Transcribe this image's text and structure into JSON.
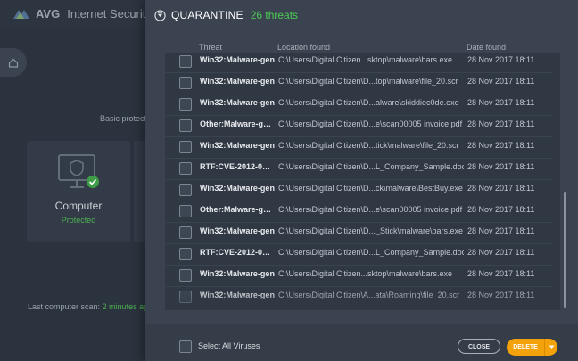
{
  "app": {
    "brand": "AVG",
    "product": "Internet Security"
  },
  "background": {
    "basic_protection": "Basic protect",
    "card_title": "Computer",
    "card_status": "Protected",
    "last_scan_label": "Last computer scan:",
    "last_scan_value": "2 minutes ag"
  },
  "quarantine": {
    "title": "QUARANTINE",
    "count_label": "26 threats",
    "columns": {
      "threat": "Threat",
      "location": "Location found",
      "date": "Date found"
    },
    "rows": [
      {
        "threat": "Win32:Malware-gen",
        "location": "C:\\Users\\Digital Citizen...sktop\\malware\\bars.exe",
        "date": "28 Nov 2017 18:11"
      },
      {
        "threat": "Win32:Malware-gen",
        "location": "C:\\Users\\Digital Citizen\\D...top\\malware\\file_20.scr",
        "date": "28 Nov 2017 18:11"
      },
      {
        "threat": "Win32:Malware-gen",
        "location": "C:\\Users\\Digital Citizen\\D...alware\\skiddiec0de.exe",
        "date": "28 Nov 2017 18:11"
      },
      {
        "threat": "Other:Malware-gen...",
        "location": "C:\\Users\\Digital Citizen\\D...e\\scan00005 invoice.pdf",
        "date": "28 Nov 2017 18:11"
      },
      {
        "threat": "Win32:Malware-gen",
        "location": "C:\\Users\\Digital Citizen\\D...tick\\malware\\file_20.scr",
        "date": "28 Nov 2017 18:11"
      },
      {
        "threat": "RTF:CVE-2012-015...",
        "location": "C:\\Users\\Digital Citizen\\D...L_Company_Sample.doc",
        "date": "28 Nov 2017 18:11"
      },
      {
        "threat": "Win32:Malware-gen",
        "location": "C:\\Users\\Digital Citizen\\D...ck\\malware\\BestBuy.exe",
        "date": "28 Nov 2017 18:11"
      },
      {
        "threat": "Other:Malware-gen...",
        "location": "C:\\Users\\Digital Citizen\\D...e\\scan00005 invoice.pdf",
        "date": "28 Nov 2017 18:11"
      },
      {
        "threat": "Win32:Malware-gen",
        "location": "C:\\Users\\Digital Citizen\\D..._Stick\\malware\\bars.exe",
        "date": "28 Nov 2017 18:11"
      },
      {
        "threat": "RTF:CVE-2012-015...",
        "location": "C:\\Users\\Digital Citizen\\D...L_Company_Sample.doc",
        "date": "28 Nov 2017 18:11"
      },
      {
        "threat": "Win32:Malware-gen",
        "location": "C:\\Users\\Digital Citizen...sktop\\malware\\bars.exe",
        "date": "28 Nov 2017 18:11"
      },
      {
        "threat": "Win32:Malware-gen",
        "location": "C:\\Users\\Digital Citizen\\A...ata\\Roaming\\file_20.scr",
        "date": "28 Nov 2017 18:11"
      }
    ],
    "select_all_label": "Select All Viruses",
    "close_label": "CLOSE",
    "delete_label": "DELETE"
  }
}
